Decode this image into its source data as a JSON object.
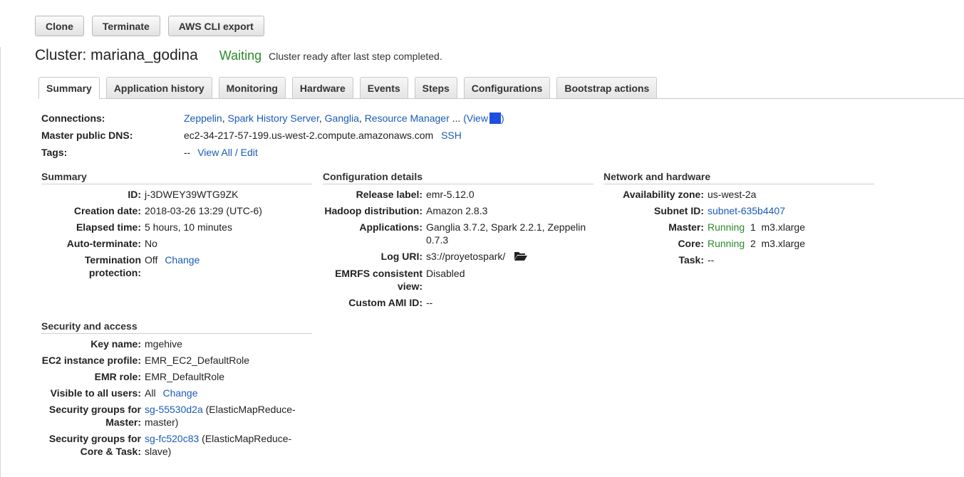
{
  "toolbar": {
    "clone": "Clone",
    "terminate": "Terminate",
    "aws_cli_export": "AWS CLI export"
  },
  "header": {
    "title": "Cluster: mariana_godina",
    "status": "Waiting",
    "status_message": "Cluster ready after last step completed.",
    "status_color": "#2b8a2b"
  },
  "tabs": [
    "Summary",
    "Application history",
    "Monitoring",
    "Hardware",
    "Events",
    "Steps",
    "Configurations",
    "Bootstrap actions"
  ],
  "top": {
    "connections_label": "Connections:",
    "connections": [
      "Zeppelin",
      "Spark History Server",
      "Ganglia",
      "Resource Manager"
    ],
    "connections_sep": ",",
    "connections_more": " ...",
    "view_label": "(View",
    "view_close": ")",
    "dns_label": "Master public DNS:",
    "dns_value": "ec2-34-217-57-199.us-west-2.compute.amazonaws.com",
    "ssh": "SSH",
    "tags_label": "Tags:",
    "tags_value": "--",
    "tags_link": "View All / Edit"
  },
  "summary": {
    "title": "Summary",
    "id_label": "ID:",
    "id": "j-3DWEY39WTG9ZK",
    "creation_label": "Creation date:",
    "creation": "2018-03-26 13:29 (UTC-6)",
    "elapsed_label": "Elapsed time:",
    "elapsed": "5 hours, 10 minutes",
    "autoterm_label": "Auto-terminate:",
    "autoterm": "No",
    "termprot_label_1": "Termination",
    "termprot_label_2": "protection:",
    "termprot": "Off",
    "termprot_change": "Change"
  },
  "config": {
    "title": "Configuration details",
    "release_label": "Release label:",
    "release": "emr-5.12.0",
    "hadoop_label": "Hadoop distribution:",
    "hadoop": "Amazon 2.8.3",
    "apps_label": "Applications:",
    "apps_1": "Ganglia 3.7.2, Spark 2.2.1, Zeppelin",
    "apps_2": "0.7.3",
    "log_label": "Log URI:",
    "log": "s3://proyetospark/",
    "emrfs_label_1": "EMRFS consistent",
    "emrfs_label_2": "view:",
    "emrfs": "Disabled",
    "ami_label": "Custom AMI ID:",
    "ami": "--"
  },
  "network": {
    "title": "Network and hardware",
    "az_label": "Availability zone:",
    "az": "us-west-2a",
    "subnet_label": "Subnet ID:",
    "subnet": "subnet-635b4407",
    "master_label": "Master:",
    "master_status": "Running",
    "master_count": "1",
    "master_type": "m3.xlarge",
    "core_label": "Core:",
    "core_status": "Running",
    "core_count": "2",
    "core_type": "m3.xlarge",
    "task_label": "Task:",
    "task": "--"
  },
  "security": {
    "title": "Security and access",
    "key_label": "Key name:",
    "key": "mgehive",
    "ec2_label": "EC2 instance profile:",
    "ec2": "EMR_EC2_DefaultRole",
    "emr_label": "EMR role:",
    "emr": "EMR_DefaultRole",
    "visible_label": "Visible to all users:",
    "visible": "All",
    "visible_change": "Change",
    "sg_master_label_1": "Security groups for",
    "sg_master_label_2": "Master:",
    "sg_master_id": "sg-55530d2a",
    "sg_master_desc_1": " (ElasticMapReduce-",
    "sg_master_desc_2": "master)",
    "sg_core_label_1": "Security groups for",
    "sg_core_label_2": "Core & Task:",
    "sg_core_id": "sg-fc520c83",
    "sg_core_desc_1": " (ElasticMapReduce-",
    "sg_core_desc_2": "slave)"
  }
}
